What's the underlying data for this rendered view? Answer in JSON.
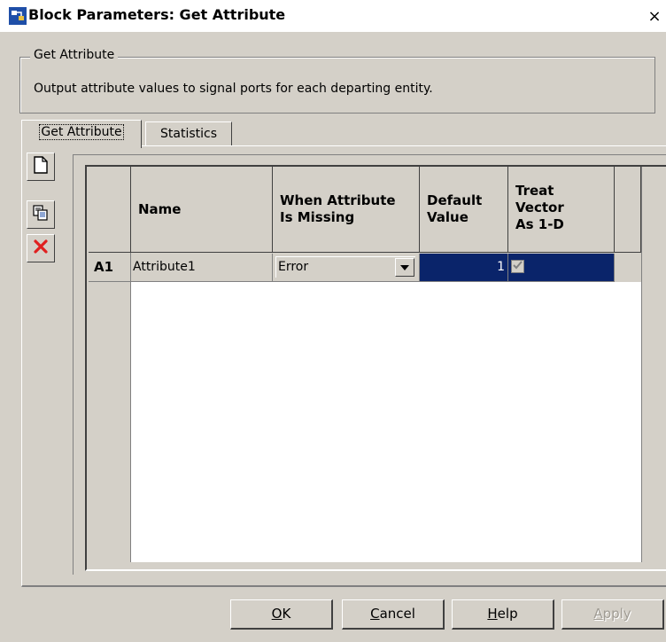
{
  "window": {
    "title": "Block Parameters: Get Attribute",
    "close_symbol": "×"
  },
  "group": {
    "legend": "Get Attribute",
    "description": "Output attribute values to signal ports for each departing entity."
  },
  "tabs": [
    {
      "label": "Get Attribute",
      "selected": true
    },
    {
      "label": "Statistics",
      "selected": false
    }
  ],
  "side_buttons": [
    {
      "icon": "new-row-icon"
    },
    {
      "icon": "copy-row-icon"
    },
    {
      "icon": "delete-row-icon"
    }
  ],
  "table": {
    "columns": [
      {
        "line1": "Name",
        "line2": "",
        "line3": ""
      },
      {
        "line1": "When Attribute",
        "line2": "Is Missing",
        "line3": ""
      },
      {
        "line1": "Default",
        "line2": "Value",
        "line3": ""
      },
      {
        "line1": "Treat",
        "line2": "Vector",
        "line3": "As 1-D"
      }
    ],
    "rows": [
      {
        "label": "A1",
        "name": "Attribute1",
        "when_missing": "Error",
        "default_value": "1",
        "treat_vector": true
      }
    ]
  },
  "buttons": {
    "ok": {
      "mnemonic": "O",
      "rest": "K"
    },
    "cancel": {
      "mnemonic": "C",
      "rest": "ancel"
    },
    "help": {
      "mnemonic": "H",
      "rest": "elp"
    },
    "apply": {
      "mnemonic": "A",
      "rest": "pply"
    }
  },
  "colors": {
    "dialog_bg": "#d4d0c8",
    "selection": "#0a246a",
    "delete_red": "#e02020"
  }
}
